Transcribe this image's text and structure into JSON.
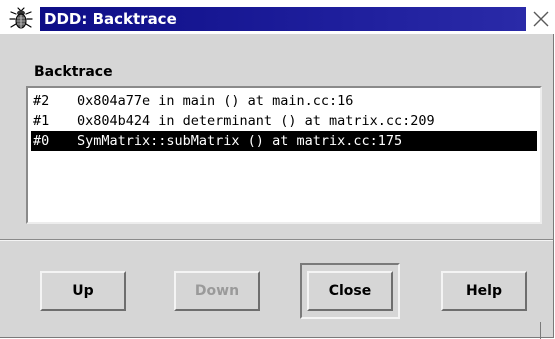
{
  "window": {
    "title": "DDD: Backtrace"
  },
  "icons": {
    "app": "ddd-bug-icon",
    "close": "close-icon"
  },
  "colors": {
    "titlebar": "#0d0d86",
    "window_bg": "#d6d6d6",
    "selection_bg": "#000000",
    "selection_fg": "#ffffff",
    "disabled_text": "#9a9a9a"
  },
  "backtrace": {
    "label": "Backtrace",
    "frames": [
      {
        "num": "#2",
        "text": "0x804a77e in main () at main.cc:16",
        "selected": false
      },
      {
        "num": "#1",
        "text": "0x804b424 in determinant () at matrix.cc:209",
        "selected": false
      },
      {
        "num": "#0",
        "text": "SymMatrix::subMatrix () at matrix.cc:175",
        "selected": true
      }
    ]
  },
  "buttons": {
    "up": {
      "label": "Up",
      "enabled": true
    },
    "down": {
      "label": "Down",
      "enabled": false
    },
    "close": {
      "label": "Close",
      "enabled": true,
      "default": true
    },
    "help": {
      "label": "Help",
      "enabled": true
    }
  }
}
